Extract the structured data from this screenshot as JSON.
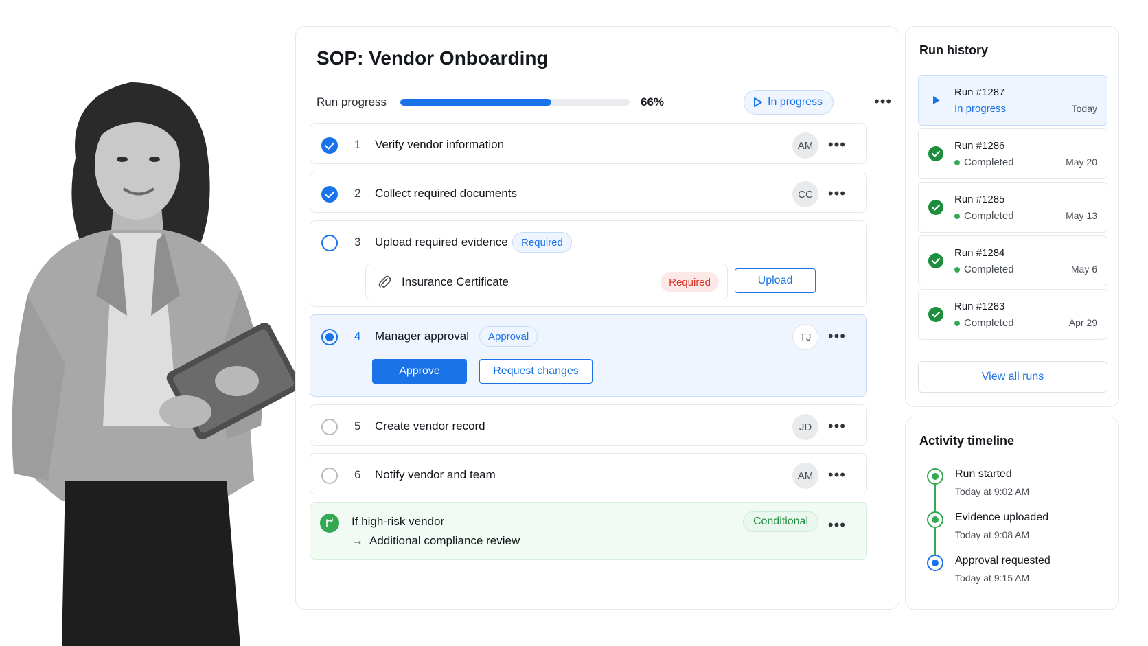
{
  "colors": {
    "accent": "#1a73e8",
    "success": "#34a853",
    "danger": "#d93025",
    "border": "#e6e8ec"
  },
  "header": {
    "title": "SOP: Vendor Onboarding",
    "progress_label": "Run progress",
    "progress_value": 0.66,
    "progress_text": "66%",
    "status": "In progress",
    "status_icon": "play-icon",
    "more": "•••"
  },
  "steps": [
    {
      "num": "1",
      "title": "Verify vendor information",
      "state": "done",
      "assignee": "AM",
      "more": "•••"
    },
    {
      "num": "2",
      "title": "Collect required documents",
      "state": "done",
      "assignee": "CC",
      "more": "•••"
    },
    {
      "num": "3",
      "title": "Upload required evidence",
      "state": "open",
      "tag": "Required",
      "subitem": {
        "icon": "paperclip-icon",
        "label": "Insurance Certificate",
        "tag": "Required",
        "action": "Upload"
      }
    },
    {
      "num": "4",
      "title": "Manager approval",
      "state": "active",
      "tag": "Approval",
      "assignee": "TJ",
      "more": "•••",
      "actions": {
        "approve": "Approve",
        "request_changes": "Request changes"
      }
    },
    {
      "num": "5",
      "title": "Create vendor record",
      "state": "pending",
      "assignee": "JD",
      "more": "•••"
    },
    {
      "num": "6",
      "title": "Notify vendor and team",
      "state": "pending",
      "assignee": "AM",
      "more": "•••"
    }
  ],
  "conditional": {
    "icon": "branch-icon",
    "condition": "If high-risk vendor",
    "arrow": "→",
    "outcome": "Additional compliance review",
    "tag": "Conditional",
    "more": "•••"
  },
  "run_history": {
    "title": "Run history",
    "runs": [
      {
        "name": "Run #1287",
        "status": "In progress",
        "date": "Today",
        "icon": "play-icon"
      },
      {
        "name": "Run #1286",
        "status": "Completed",
        "date": "May 20",
        "icon": "check-circle-icon"
      },
      {
        "name": "Run #1285",
        "status": "Completed",
        "date": "May 13",
        "icon": "check-circle-icon"
      },
      {
        "name": "Run #1284",
        "status": "Completed",
        "date": "May 6",
        "icon": "check-circle-icon"
      },
      {
        "name": "Run #1283",
        "status": "Completed",
        "date": "Apr 29",
        "icon": "check-circle-icon"
      }
    ],
    "view_all": "View all runs"
  },
  "activity": {
    "title": "Activity timeline",
    "events": [
      {
        "title": "Run started",
        "time": "Today at 9:02 AM"
      },
      {
        "title": "Evidence uploaded",
        "time": "Today at 9:08 AM"
      },
      {
        "title": "Approval requested",
        "time": "Today at 9:15 AM"
      }
    ]
  }
}
